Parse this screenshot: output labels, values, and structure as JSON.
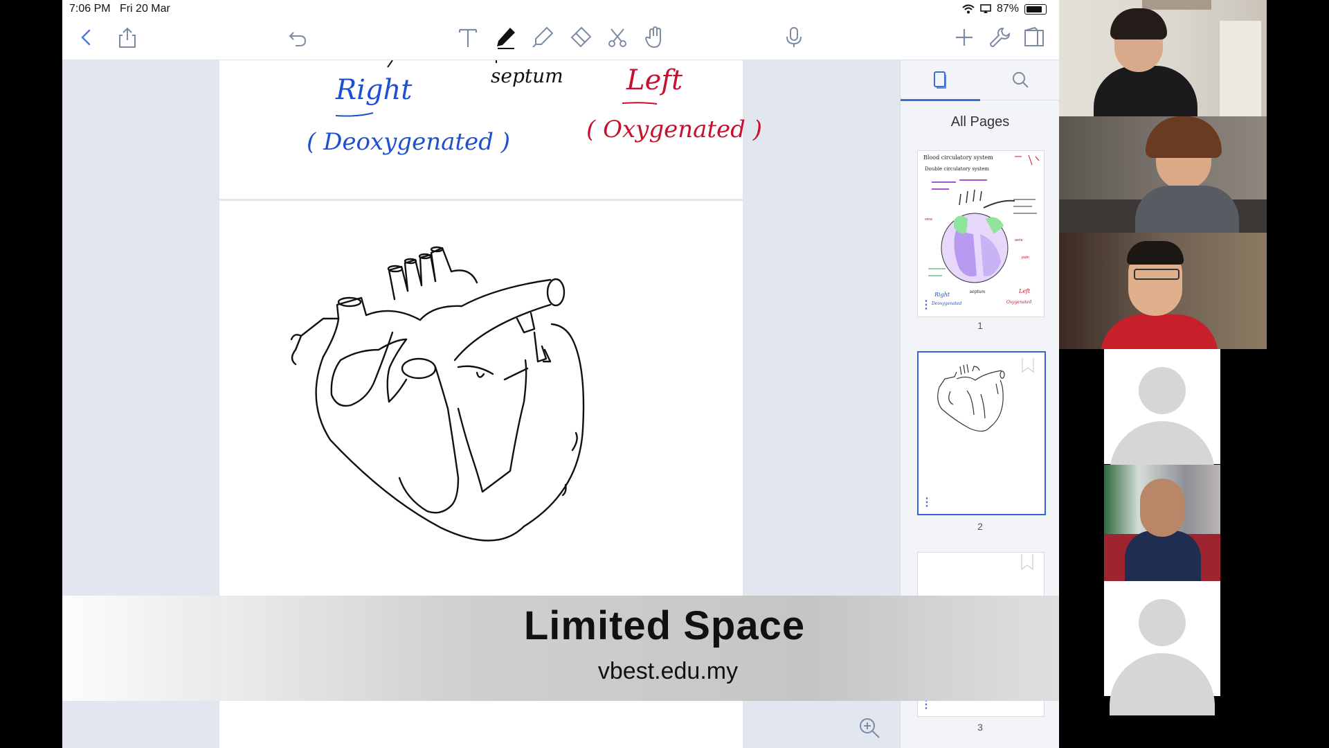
{
  "status_bar": {
    "time": "7:06 PM",
    "date": "Fri 20 Mar",
    "battery": "87%",
    "battery_level": 0.87
  },
  "toolbar": {
    "left": [
      "back-icon",
      "share-icon"
    ],
    "center_left": "undo-icon",
    "tools": [
      "text-tool-icon",
      "pen-tool-icon",
      "highlighter-tool-icon",
      "eraser-tool-icon",
      "lasso-tool-icon",
      "hand-tool-icon"
    ],
    "mic": "microphone-icon",
    "right": [
      "add-icon",
      "wrench-icon",
      "book-icon"
    ]
  },
  "note": {
    "label_septum": "septum",
    "label_right": "Right",
    "label_left": "Left",
    "label_deoxygenated": "( Deoxygenated )",
    "label_oxygenated": "( Oxygenated )"
  },
  "sidebar": {
    "tabs": [
      "pages-tab-icon",
      "search-tab-icon"
    ],
    "heading": "All Pages",
    "pages": [
      {
        "number": "1",
        "selected": false
      },
      {
        "number": "2",
        "selected": true
      },
      {
        "number": "3",
        "selected": false
      }
    ],
    "thumb1_text": {
      "title": "Blood circulatory system",
      "line1": "Double circulatory system",
      "right": "Right",
      "deoxy": "Deoxygenated",
      "left": "Left",
      "oxy": "Oxygenated",
      "septum": "septum"
    }
  },
  "banner": {
    "title": "Limited Space",
    "url": "vbest.edu.my"
  },
  "participants": [
    "participant-1-video",
    "participant-2-video",
    "participant-3-video",
    "participant-4-avatar",
    "participant-5-video",
    "participant-6-avatar"
  ]
}
